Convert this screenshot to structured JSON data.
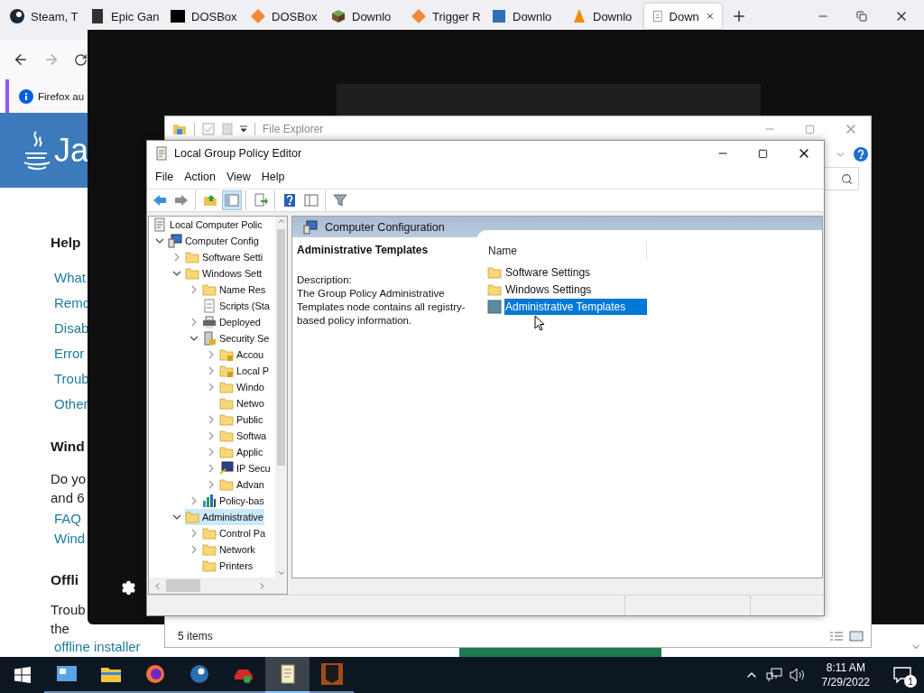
{
  "browser": {
    "tabs": [
      {
        "label": "Steam, T",
        "kind": "steam",
        "selected": false
      },
      {
        "label": "Epic Gan",
        "kind": "epic",
        "selected": false
      },
      {
        "label": "DOSBox",
        "kind": "dosbox",
        "selected": false
      },
      {
        "label": "DOSBox",
        "kind": "diamond",
        "selected": false
      },
      {
        "label": "Downlo",
        "kind": "cube",
        "selected": false
      },
      {
        "label": "Trigger R",
        "kind": "diamond",
        "selected": false
      },
      {
        "label": "Downlo",
        "kind": "bluebox",
        "selected": false
      },
      {
        "label": "Downlo",
        "kind": "cone",
        "selected": false
      },
      {
        "label": "Down",
        "kind": "java",
        "selected": true
      }
    ],
    "notification": "Firefox au",
    "page": {
      "logo_text": "Ja",
      "heading": "Help",
      "links": [
        "What",
        "Remo",
        "Disab",
        "Error",
        "Troub",
        "Other"
      ],
      "section2": {
        "heading": "Wind",
        "text": [
          "Do yo",
          "and 6"
        ],
        "links": [
          "FAQ",
          "Wind"
        ]
      },
      "section3": {
        "heading": "Offli",
        "text": [
          "Troub",
          "the"
        ],
        "link": "offline installer"
      }
    }
  },
  "explorer": {
    "title": "File Explorer",
    "status": "5 items"
  },
  "gpe": {
    "title": "Local Group Policy Editor",
    "menu": [
      "File",
      "Action",
      "View",
      "Help"
    ],
    "toolbar": [
      [
        {
          "kind": "back",
          "pressed": false
        },
        {
          "kind": "forward",
          "pressed": false
        }
      ],
      [
        {
          "kind": "up",
          "pressed": false
        },
        {
          "kind": "tree",
          "pressed": true
        }
      ],
      [
        {
          "kind": "export",
          "pressed": false
        }
      ],
      [
        {
          "kind": "help",
          "pressed": false
        },
        {
          "kind": "view",
          "pressed": false
        }
      ],
      [
        {
          "kind": "filter",
          "pressed": false
        }
      ]
    ],
    "tree": {
      "label": "Local Computer Polic",
      "kind": "scroll",
      "selected": false,
      "children": [
        {
          "label": "Computer Config",
          "kind": "computer",
          "expandable": true,
          "expanded": true,
          "selected": false,
          "children": [
            {
              "label": "Software Setti",
              "kind": "folder",
              "expandable": true,
              "expanded": false,
              "selected": false
            },
            {
              "label": "Windows Sett",
              "kind": "folder",
              "expandable": true,
              "expanded": true,
              "selected": false,
              "children": [
                {
                  "label": "Name Res",
                  "kind": "folder",
                  "expandable": true,
                  "expanded": false,
                  "selected": false
                },
                {
                  "label": "Scripts (Sta",
                  "kind": "script",
                  "expandable": false,
                  "selected": false
                },
                {
                  "label": "Deployed",
                  "kind": "printer",
                  "expandable": true,
                  "expanded": false,
                  "selected": false
                },
                {
                  "label": "Security Se",
                  "kind": "security",
                  "expandable": true,
                  "expanded": true,
                  "selected": false,
                  "children": [
                    {
                      "label": "Accou",
                      "kind": "lockfolder",
                      "expandable": true,
                      "expanded": false,
                      "selected": false
                    },
                    {
                      "label": "Local P",
                      "kind": "lockfolder",
                      "expandable": true,
                      "expanded": false,
                      "selected": false
                    },
                    {
                      "label": "Windo",
                      "kind": "folder",
                      "expandable": true,
                      "expanded": false,
                      "selected": false
                    },
                    {
                      "label": "Netwo",
                      "kind": "folder",
                      "expandable": false,
                      "selected": false
                    },
                    {
                      "label": "Public",
                      "kind": "folder",
                      "expandable": true,
                      "expanded": false,
                      "selected": false
                    },
                    {
                      "label": "Softwa",
                      "kind": "folder",
                      "expandable": true,
                      "expanded": false,
                      "selected": false
                    },
                    {
                      "label": "Applic",
                      "kind": "folder",
                      "expandable": true,
                      "expanded": false,
                      "selected": false
                    },
                    {
                      "label": "IP Secu",
                      "kind": "monitor",
                      "expandable": true,
                      "expanded": false,
                      "selected": false
                    },
                    {
                      "label": "Advan",
                      "kind": "folder",
                      "expandable": true,
                      "expanded": false,
                      "selected": false
                    }
                  ]
                },
                {
                  "label": "Policy-bas",
                  "kind": "chart",
                  "expandable": true,
                  "expanded": false,
                  "selected": false
                }
              ]
            },
            {
              "label": "Administrative",
              "kind": "folder",
              "expandable": true,
              "expanded": true,
              "selected": true,
              "children": [
                {
                  "label": "Control Pa",
                  "kind": "folder",
                  "expandable": true,
                  "expanded": false,
                  "selected": false
                },
                {
                  "label": "Network",
                  "kind": "folder",
                  "expandable": true,
                  "expanded": false,
                  "selected": false
                },
                {
                  "label": "Printers",
                  "kind": "folder",
                  "expandable": false,
                  "selected": false
                }
              ]
            }
          ]
        }
      ]
    },
    "header": "Computer Configuration",
    "detail_title": "Administrative Templates",
    "description_label": "Description:",
    "description_lines": [
      "The Group Policy Administrative",
      "Templates node contains all registry-",
      "based policy information."
    ],
    "column": "Name",
    "items": [
      {
        "label": "Software Settings",
        "kind": "folder",
        "selected": false
      },
      {
        "label": "Windows Settings",
        "kind": "folder",
        "selected": false
      },
      {
        "label": "Administrative Templates",
        "kind": "admx",
        "selected": true
      }
    ]
  },
  "taskbar": {
    "apps": [
      {
        "kind": "control",
        "active": false
      },
      {
        "kind": "explorer",
        "active": false
      },
      {
        "kind": "firefox",
        "active": false
      },
      {
        "kind": "steam",
        "active": false
      },
      {
        "kind": "car",
        "active": false
      },
      {
        "kind": "gpe",
        "active": true
      },
      {
        "kind": "epic",
        "active": false
      }
    ],
    "time": "8:11 AM",
    "date": "7/29/2022",
    "notification_count": "1"
  }
}
